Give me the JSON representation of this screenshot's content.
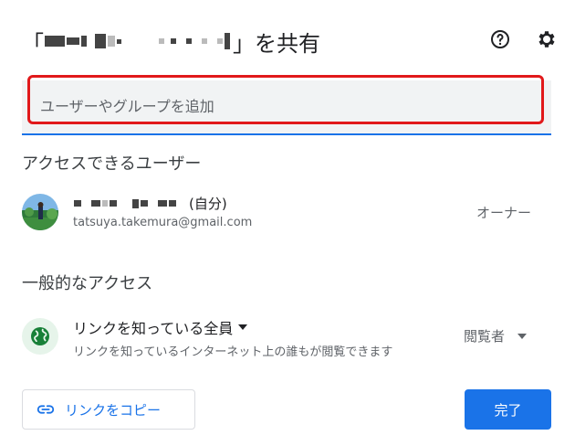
{
  "dialog": {
    "title_open": "「",
    "title_close": "」を共有",
    "help_icon": "help-circle-icon",
    "settings_icon": "gear-icon"
  },
  "search": {
    "placeholder": "ユーザーやグループを追加"
  },
  "people_section": {
    "title": "アクセスできるユーザー",
    "users": [
      {
        "name_suffix": "(自分)",
        "email": "tatsuya.takemura@gmail.com",
        "role": "オーナー"
      }
    ]
  },
  "general_access": {
    "title": "一般的なアクセス",
    "type": "リンクを知っている全員",
    "description": "リンクを知っているインターネット上の誰もが閲覧できます",
    "role": "閲覧者",
    "icon": "globe-icon"
  },
  "footer": {
    "copy_link_label": "リンクをコピー",
    "done_label": "完了"
  },
  "colors": {
    "accent": "#1a73e8",
    "highlight": "#e1191b",
    "globe_bg": "#e6f4ea",
    "globe_fg": "#188038"
  }
}
